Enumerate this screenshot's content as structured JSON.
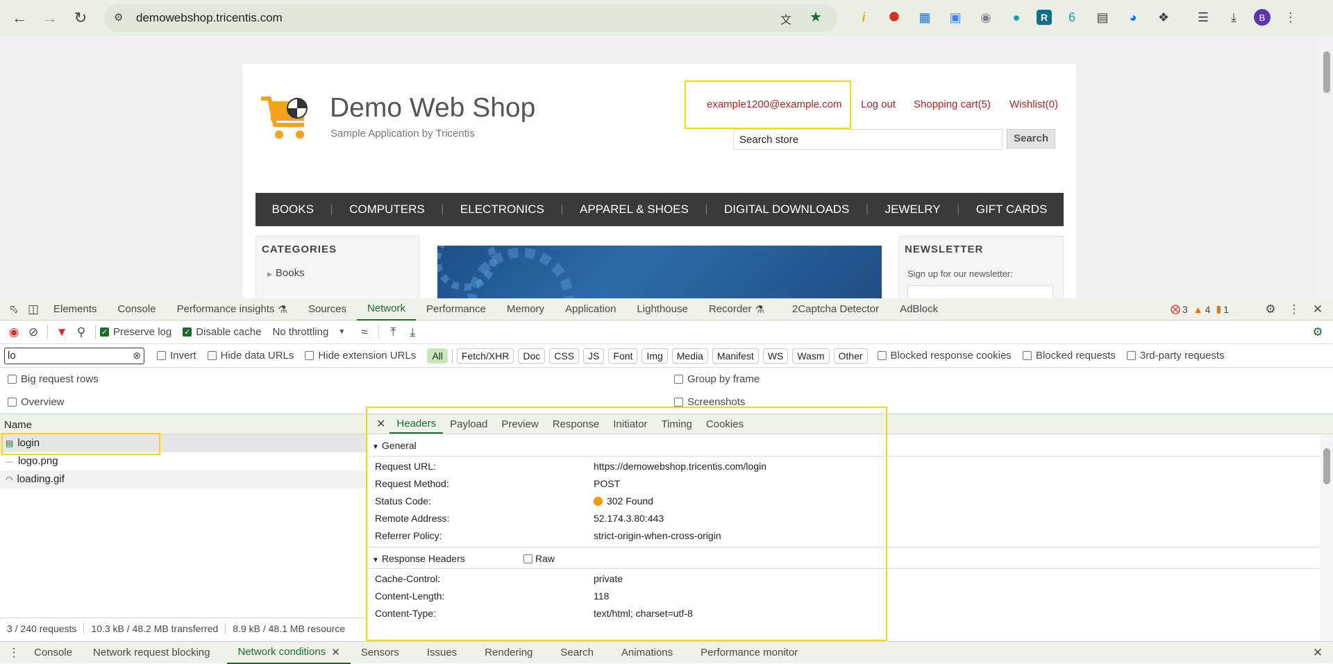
{
  "browser": {
    "url": "demowebshop.tricentis.com",
    "profile_initial": "B"
  },
  "shop": {
    "title": "Demo Web Shop",
    "subtitle": "Sample Application by Tricentis",
    "account": "example1200@example.com",
    "logout": "Log out",
    "cart": "Shopping cart(5)",
    "wishlist": "Wishlist(0)",
    "search_value": "Search store",
    "search_button": "Search",
    "menu": [
      "BOOKS",
      "COMPUTERS",
      "ELECTRONICS",
      "APPAREL & SHOES",
      "DIGITAL DOWNLOADS",
      "JEWELRY",
      "GIFT CARDS"
    ],
    "categories_title": "CATEGORIES",
    "category_first": "Books",
    "newsletter_title": "NEWSLETTER",
    "newsletter_text": "Sign up for our newsletter:"
  },
  "devtools": {
    "tabs": [
      "Elements",
      "Console",
      "Performance insights",
      "Sources",
      "Network",
      "Performance",
      "Memory",
      "Application",
      "Lighthouse",
      "Recorder",
      "2Captcha Detector",
      "AdBlock"
    ],
    "active_tab": "Network",
    "errors": "3",
    "warnings": "4",
    "issues": "1",
    "preserve_log": "Preserve log",
    "disable_cache": "Disable cache",
    "throttling": "No throttling",
    "filter_value": "lo",
    "invert": "Invert",
    "hide_data_urls": "Hide data URLs",
    "hide_ext_urls": "Hide extension URLs",
    "type_filters": [
      "All",
      "Fetch/XHR",
      "Doc",
      "CSS",
      "JS",
      "Font",
      "Img",
      "Media",
      "Manifest",
      "WS",
      "Wasm",
      "Other"
    ],
    "blocked_cookies": "Blocked response cookies",
    "blocked_requests": "Blocked requests",
    "third_party": "3rd-party requests",
    "big_rows": "Big request rows",
    "overview": "Overview",
    "group_by_frame": "Group by frame",
    "screenshots": "Screenshots",
    "name_col": "Name",
    "requests": [
      "login",
      "logo.png",
      "loading.gif"
    ],
    "detail_tabs": [
      "Headers",
      "Payload",
      "Preview",
      "Response",
      "Initiator",
      "Timing",
      "Cookies"
    ],
    "general_title": "General",
    "general": [
      {
        "label": "Request URL:",
        "value": "https://demowebshop.tricentis.com/login"
      },
      {
        "label": "Request Method:",
        "value": "POST"
      },
      {
        "label": "Status Code:",
        "value": "302 Found"
      },
      {
        "label": "Remote Address:",
        "value": "52.174.3.80:443"
      },
      {
        "label": "Referrer Policy:",
        "value": "strict-origin-when-cross-origin"
      }
    ],
    "response_title": "Response Headers",
    "raw": "Raw",
    "response": [
      {
        "label": "Cache-Control:",
        "value": "private"
      },
      {
        "label": "Content-Length:",
        "value": "118"
      },
      {
        "label": "Content-Type:",
        "value": "text/html; charset=utf-8"
      }
    ],
    "status_bar": {
      "requests": "3 / 240 requests",
      "transferred": "10.3 kB / 48.2 MB transferred",
      "resources": "8.9 kB / 48.1 MB resource"
    },
    "drawer_tabs": [
      "Console",
      "Network request blocking",
      "Network conditions",
      "Sensors",
      "Issues",
      "Rendering",
      "Search",
      "Animations",
      "Performance monitor"
    ],
    "drawer_active": "Network conditions"
  }
}
